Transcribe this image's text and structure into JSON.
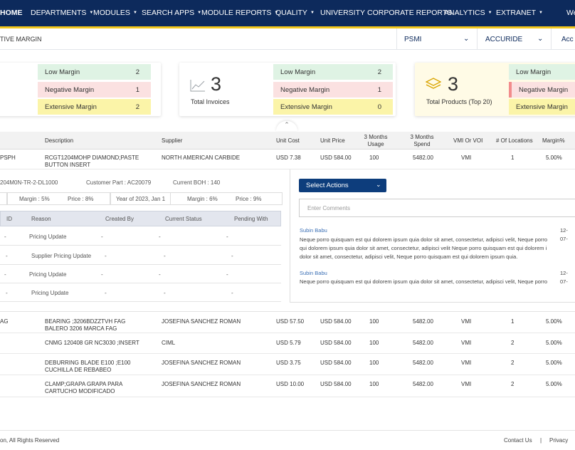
{
  "nav": {
    "home": "HOME",
    "departments": "DEPARTMENTS",
    "modules": "MODULES",
    "search_apps": "SEARCH APPS",
    "module_reports": "MODULE REPORTS",
    "quality": "QUALITY",
    "university": "UNIVERSITY",
    "corporate_reports": "CORPORATE REPORTS",
    "analytics": "ANALYTICS",
    "extranet": "EXTRANET",
    "user": "We"
  },
  "subbar": {
    "breadcrumb": "TIVE MARGIN",
    "select1": "PSMI",
    "select2": "ACCURIDE",
    "select3": "Acc"
  },
  "cards": [
    {
      "metrics": [
        {
          "label": "Low Margin",
          "value": "2"
        },
        {
          "label": "Negative Margin",
          "value": "1"
        },
        {
          "label": "Extensive Margin",
          "value": "2"
        }
      ]
    },
    {
      "number": "3",
      "label": "Total Invoices",
      "icon": "trend-chart-icon",
      "metrics": [
        {
          "label": "Low Margin",
          "value": "2"
        },
        {
          "label": "Negative Margin",
          "value": "1"
        },
        {
          "label": "Extensive Margin",
          "value": "0"
        }
      ]
    },
    {
      "number": "3",
      "label": "Total Products (Top 20)",
      "icon": "layers-icon",
      "metrics": [
        {
          "label": "Low Margin"
        },
        {
          "label": "Negative Margin"
        },
        {
          "label": "Extensive Margin"
        }
      ]
    }
  ],
  "table": {
    "headers": [
      "Description",
      "Supplier",
      "Unit Cost",
      "Unit Price",
      "3 Months Usage",
      "3 Months Spend",
      "VMI Or VOI",
      "# Of Locations",
      "Margin%"
    ],
    "rows": [
      {
        "part": "PSPH",
        "desc1": "RCGT1204MOHP DIAMOND;PASTE",
        "desc2": "BUTTON INSERT",
        "supplier": "NORTH AMERICAN CARBIDE",
        "cost": "USD 7.38",
        "price": "USD 584.00",
        "usage": "100",
        "spend": "5482.00",
        "vmi": "VMI",
        "loc": "1",
        "margin": "5.00%"
      },
      {
        "part": "AG",
        "desc1": "BEARING ;3206BDZZTVH FAG",
        "desc2": "BALERO 3206 MARCA FAG",
        "supplier": "JOSEFINA SANCHEZ ROMAN",
        "cost": "USD 57.50",
        "price": "USD 584.00",
        "usage": "100",
        "spend": "5482.00",
        "vmi": "VMI",
        "loc": "1",
        "margin": "5.00%"
      },
      {
        "part": "",
        "desc1": "CNMG 120408 GR NC3030 ;INSERT",
        "desc2": "",
        "supplier": "CIML",
        "cost": "USD 5.79",
        "price": "USD 584.00",
        "usage": "100",
        "spend": "5482.00",
        "vmi": "VMI",
        "loc": "2",
        "margin": "5.00%"
      },
      {
        "part": "",
        "desc1": "DEBURRING BLADE E100 ;E100",
        "desc2": "CUCHILLA DE REBABEO",
        "supplier": "JOSEFINA SANCHEZ ROMAN",
        "cost": "USD 3.75",
        "price": "USD 584.00",
        "usage": "100",
        "spend": "5482.00",
        "vmi": "VMI",
        "loc": "2",
        "margin": "5.00%"
      },
      {
        "part": "",
        "desc1": "CLAMP;GRAPA GRAPA PARA",
        "desc2": "CARTUCHO MODIFICADO",
        "supplier": "JOSEFINA SANCHEZ ROMAN",
        "cost": "USD 10.00",
        "price": "USD 584.00",
        "usage": "100",
        "spend": "5482.00",
        "vmi": "VMI",
        "loc": "2",
        "margin": "5.00%"
      }
    ]
  },
  "detail": {
    "part_no": "204M0N-TR-2-DL1000",
    "customer_part": "Customer Part : AC20079",
    "current_boh": "Current BOH : 140",
    "tabs": [
      {
        "margin": "Margin : 5%",
        "price": "Price : 8%"
      },
      {
        "year": "Year of 2023, Jan 1",
        "margin": "Margin : 6%",
        "price": "Price : 9%"
      }
    ],
    "history_headers": [
      "ID",
      "Reason",
      "Created By",
      "Current Status",
      "Pending With"
    ],
    "history_rows": [
      {
        "id": "-",
        "reason": "Pricing Update",
        "created": "-",
        "status": "-",
        "pending": "-"
      },
      {
        "id": "-",
        "reason": "Supplier Pricing Update",
        "created": "-",
        "status": "-",
        "pending": "-"
      },
      {
        "id": "-",
        "reason": "Pricing Update",
        "created": "-",
        "status": "-",
        "pending": "-"
      },
      {
        "id": "-",
        "reason": "Pricing Update",
        "created": "-",
        "status": "-",
        "pending": "-"
      }
    ],
    "select_actions": "Select Actions",
    "comment_placeholder": "Enter Comments",
    "comments": [
      {
        "author": "Subin Babu",
        "date": "12-07-",
        "lines": [
          "Neque porro quisquam est qui dolorem ipsum quia dolor sit amet, consectetur, adipisci velit, Neque porro",
          "qui dolorem ipsum quia dolor sit amet, consectetur, adipisci velit Neque porro quisquam est qui dolorem i",
          "dolor sit amet, consectetur, adipisci velit, Neque porro quisquam est qui dolorem ipsum quia."
        ]
      },
      {
        "author": "Subin Babu",
        "date": "12-07-",
        "lines": [
          "Neque porro quisquam est qui dolorem ipsum quia dolor sit amet, consectetur, adipisci velit, Neque porro"
        ]
      }
    ]
  },
  "footer": {
    "copyright": "on, All Rights Reserved",
    "contact": "Contact Us",
    "sep": "|",
    "privacy": "Privacy"
  }
}
